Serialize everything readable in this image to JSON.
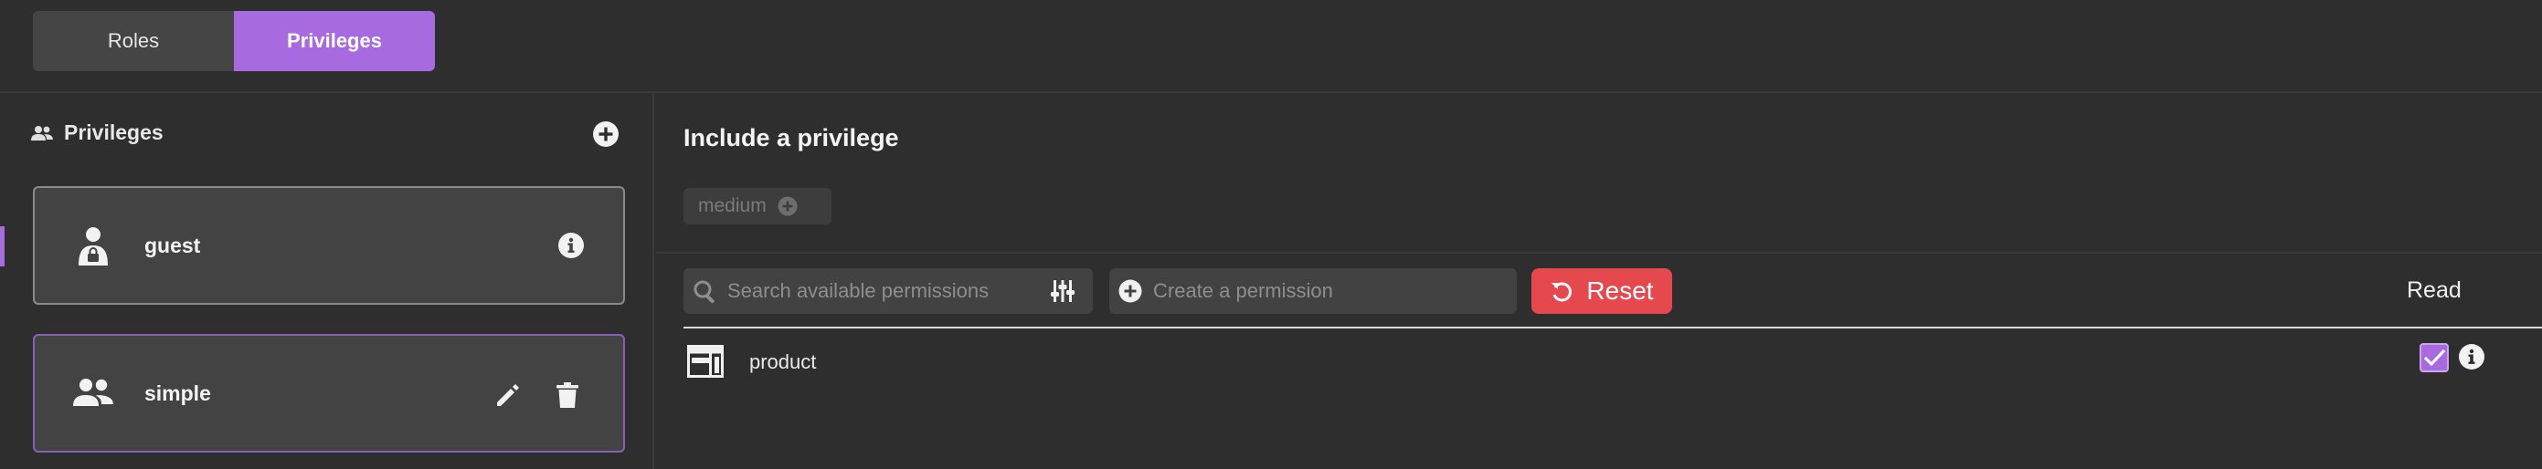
{
  "tabs": [
    {
      "label": "Roles",
      "active": false
    },
    {
      "label": "Privileges",
      "active": true
    }
  ],
  "sidebar": {
    "title": "Privileges",
    "title_icon": "people-icon",
    "add_icon": "plus-circle-icon",
    "items": [
      {
        "label": "guest",
        "icon": "user-lock-icon",
        "actions": [
          "info-icon"
        ]
      },
      {
        "label": "simple",
        "icon": "people-icon",
        "actions": [
          "pencil-icon",
          "trash-icon"
        ],
        "selected": true
      }
    ]
  },
  "main": {
    "title": "Include a privilege",
    "chips": [
      {
        "label": "medium",
        "icon": "plus-circle-icon"
      }
    ],
    "search": {
      "placeholder": "Search available permissions"
    },
    "create": {
      "placeholder": "Create a permission"
    },
    "reset_label": "Reset",
    "columns": [
      "Read"
    ],
    "rows": [
      {
        "label": "product",
        "icon": "table-icon",
        "read": true
      }
    ]
  },
  "colors": {
    "accent": "#a86adf",
    "danger": "#e5484d",
    "background": "#2e2e2e"
  }
}
